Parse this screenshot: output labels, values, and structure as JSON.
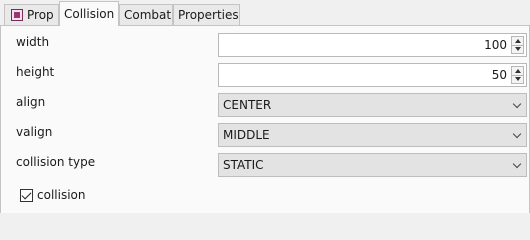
{
  "tabs": [
    {
      "label": "Prop",
      "icon": "prop-icon",
      "active": false
    },
    {
      "label": "Collision",
      "active": true
    },
    {
      "label": "Combat",
      "active": false
    },
    {
      "label": "Properties",
      "active": false
    }
  ],
  "fields": {
    "width": {
      "label": "width",
      "value": "100"
    },
    "height": {
      "label": "height",
      "value": "50"
    },
    "align": {
      "label": "align",
      "value": "CENTER"
    },
    "valign": {
      "label": "valign",
      "value": "MIDDLE"
    },
    "collision_type": {
      "label": "collision type",
      "value": "STATIC"
    }
  },
  "collision_checkbox": {
    "label": "collision",
    "checked": true
  },
  "icons": {
    "spinner_up": "chevron-up-icon",
    "spinner_down": "chevron-down-icon",
    "combo_arrow": "chevron-down-icon",
    "checkbox_mark": "check-icon"
  }
}
